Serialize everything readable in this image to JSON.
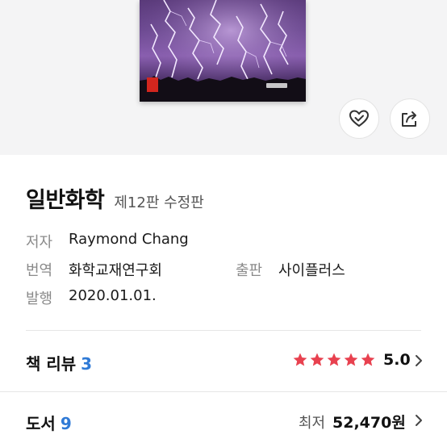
{
  "book": {
    "title": "일반화학",
    "edition": "제12판 수정판"
  },
  "meta": {
    "author_label": "저자",
    "author_value": "Raymond Chang",
    "translator_label": "번역",
    "translator_value": "화학교재연구회",
    "publisher_label": "출판",
    "publisher_value": "사이플러스",
    "date_label": "발행",
    "date_value": "2020.01.01."
  },
  "reviews": {
    "label": "책 리뷰",
    "count": "3",
    "rating": "5.0",
    "stars": 5,
    "star_color": "#e8414f"
  },
  "listings": {
    "label": "도서",
    "count": "9",
    "price_label": "최저",
    "price_value": "52,470원"
  },
  "actions": {
    "like_icon": "heart-check-icon",
    "share_icon": "share-icon"
  },
  "colors": {
    "accent_blue": "#2f7ad6",
    "hero_bg": "#f4f4f5"
  }
}
